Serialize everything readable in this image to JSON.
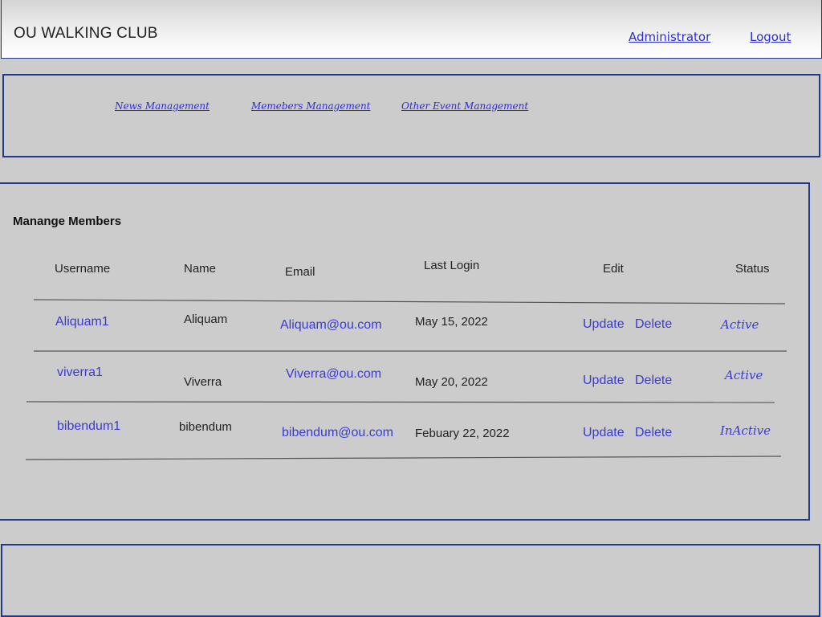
{
  "header": {
    "title": "OU WALKING CLUB",
    "user_link": "Administrator",
    "logout_link": "Logout"
  },
  "nav": {
    "items": [
      {
        "label": "News Management"
      },
      {
        "label": "Memebers Management"
      },
      {
        "label": "Other Event Management"
      }
    ]
  },
  "members": {
    "title": "Manange Members",
    "columns": [
      "Username",
      "Name",
      "Email",
      "Last Login",
      "Edit",
      "Status"
    ],
    "rows": [
      {
        "username": "Aliquam1",
        "name": "Aliquam",
        "email": "Aliquam@ou.com",
        "last_login": "May 15, 2022",
        "update": "Update",
        "delete": "Delete",
        "status": "Active"
      },
      {
        "username": "viverra1",
        "name": "Viverra",
        "email": "Viverra@ou.com",
        "last_login": "May 20, 2022",
        "update": "Update",
        "delete": "Delete",
        "status": "Active"
      },
      {
        "username": "bibendum1",
        "name": "bibendum",
        "email": "bibendum@ou.com",
        "last_login": "Febuary 22, 2022",
        "update": "Update",
        "delete": "Delete",
        "status": "InActive"
      }
    ]
  },
  "colors": {
    "border": "#1f3a8a",
    "link": "#2b2bdc",
    "background": "#cccccc"
  }
}
